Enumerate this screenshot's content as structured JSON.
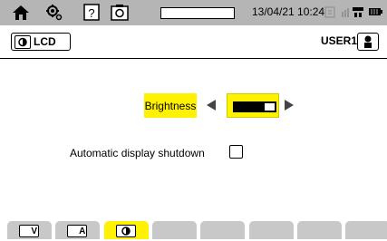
{
  "status_bar": {
    "icons": [
      "home-icon",
      "settings-icon",
      "help-icon",
      "screenshot-icon",
      "memory-icon",
      "network-icon",
      "battery-icon"
    ],
    "progress_fraction": 0.0,
    "datetime": "13/04/21 10:24"
  },
  "title_bar": {
    "mode_icon": "display-icon",
    "mode_label": "LCD",
    "user_label": "USER1",
    "user_icon": "user-icon"
  },
  "settings": {
    "brightness_label": "Brightness",
    "brightness_level": 0.75,
    "shutdown_label": "Automatic display shutdown",
    "shutdown_checked": false
  },
  "tabs": [
    {
      "label": "V",
      "icon": "voltage-tab-icon",
      "active": false
    },
    {
      "label": "A",
      "icon": "current-tab-icon",
      "active": false
    },
    {
      "label": "",
      "icon": "display-tab-icon",
      "active": true
    },
    {
      "label": "",
      "icon": "",
      "active": false
    },
    {
      "label": "",
      "icon": "",
      "active": false
    },
    {
      "label": "",
      "icon": "",
      "active": false
    },
    {
      "label": "",
      "icon": "",
      "active": false
    },
    {
      "label": "",
      "icon": "",
      "active": false
    }
  ],
  "colors": {
    "status_bar_bg": "#b5b5b5",
    "highlight": "#fff200",
    "tab_inactive": "#c8c8c8"
  }
}
